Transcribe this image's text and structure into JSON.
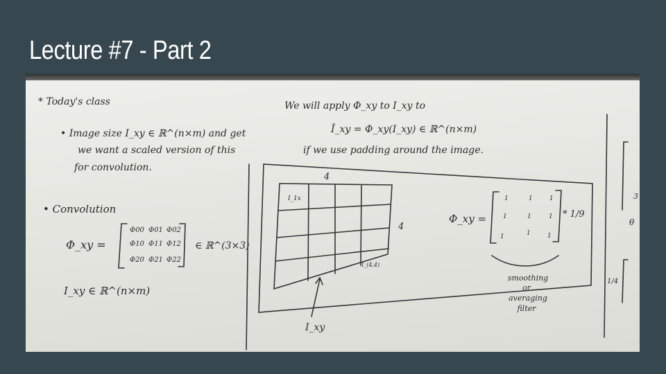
{
  "slide": {
    "title": "Lecture #7 - Part 2"
  },
  "whiteboard": {
    "lines": {
      "todays_class": "* Today's class",
      "image_size": "• Image size  I_xy ∈ ℝ^(n×m)  and  get",
      "scaled_version": "we want  a scaled version of this",
      "for_convolution": "for convolution.",
      "apply_line": "We will apply  Φ_xy  to  I_xy  to",
      "get_result": "Î_xy = Φ_xy(I_xy) ∈ ℝ^(n×m)",
      "padding_line": "if  we use padding around the image.",
      "convolution_heading": "• Convolution",
      "phi_eq": "Φ_xy  =",
      "in_r33": "∈ ℝ^(3×3)",
      "ixy_in": "I_xy ∈ ℝ^(n×m)"
    },
    "matrix_phi": [
      [
        "Φ00",
        "Φ01",
        "Φ02"
      ],
      [
        "Φ10",
        "Φ11",
        "Φ12"
      ],
      [
        "Φ20",
        "Φ21",
        "Φ22"
      ]
    ],
    "grid": {
      "width_label": "4",
      "height_label": "4",
      "corner_label_top": "I_1x",
      "corner_label_bottom": "I_(4,4)",
      "arrow_label": "I_xy"
    },
    "filter": {
      "lhs": "Φ_xy  =",
      "ones": [
        "1",
        "1",
        "1",
        "1",
        "1",
        "1",
        "1",
        "1",
        "1"
      ],
      "scale": "* 1/9",
      "caption": [
        "smoothing",
        "or",
        "averaging",
        "filter"
      ]
    },
    "right_edge": [
      "3",
      "θ",
      "1/4"
    ]
  }
}
